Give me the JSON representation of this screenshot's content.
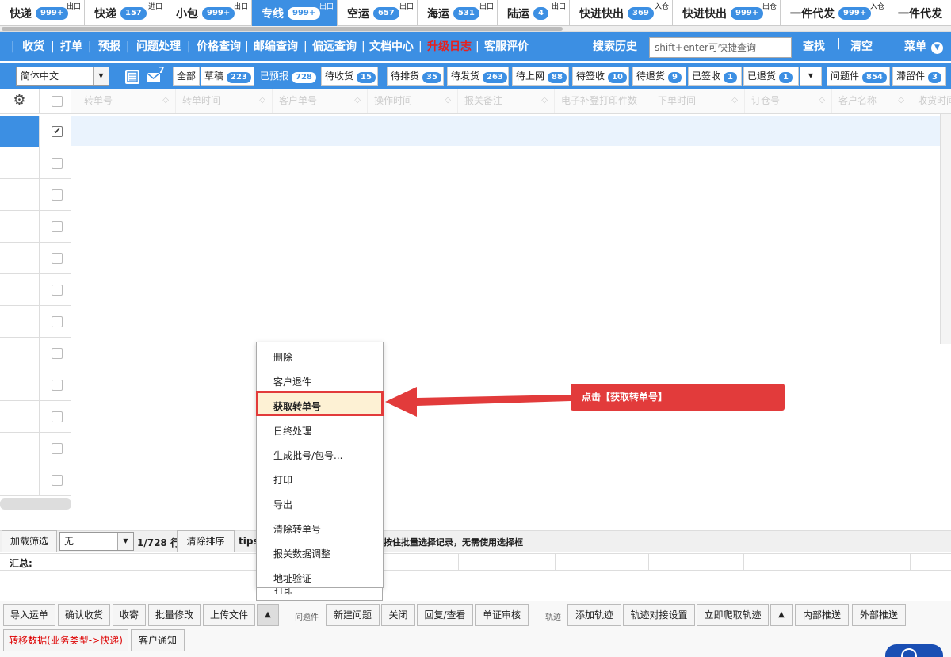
{
  "top_tabs": [
    {
      "label": "快递",
      "count": "999+",
      "sup": "出口"
    },
    {
      "label": "快递",
      "count": "157",
      "sup": "进口"
    },
    {
      "label": "小包",
      "count": "999+",
      "sup": "出口"
    },
    {
      "label": "专线",
      "count": "999+",
      "sup": "出口",
      "active": true
    },
    {
      "label": "空运",
      "count": "657",
      "sup": "出口"
    },
    {
      "label": "海运",
      "count": "531",
      "sup": "出口"
    },
    {
      "label": "陆运",
      "count": "4",
      "sup": "出口"
    },
    {
      "label": "快进快出",
      "count": "369",
      "sup": "入仓"
    },
    {
      "label": "快进快出",
      "count": "999+",
      "sup": "出仓"
    },
    {
      "label": "一件代发",
      "count": "999+",
      "sup": "入仓"
    },
    {
      "label": "一件代发",
      "count": "",
      "sup": ""
    }
  ],
  "nav": {
    "items": [
      "收货",
      "打单",
      "预报",
      "问题处理",
      "价格查询",
      "邮编查询",
      "偏远查询",
      "文档中心",
      "升级日志",
      "客服评价"
    ],
    "search_history": "搜索历史",
    "search_placeholder": "shift+enter可快捷查询",
    "find": "查找",
    "clear": "清空",
    "menu": "菜单"
  },
  "filter": {
    "language": "简体中文",
    "mail_badge": "7",
    "tabs": [
      {
        "label": "全部",
        "count": ""
      },
      {
        "label": "草稿",
        "count": "223"
      },
      {
        "label": "已预报",
        "count": "728",
        "active": true
      },
      {
        "label": "待收货",
        "count": "15"
      },
      {
        "label": "待排货",
        "count": "35"
      },
      {
        "label": "待发货",
        "count": "263"
      },
      {
        "label": "待上网",
        "count": "88"
      },
      {
        "label": "待签收",
        "count": "10"
      },
      {
        "label": "待退货",
        "count": "9"
      },
      {
        "label": "已签收",
        "count": "1"
      },
      {
        "label": "已退货",
        "count": "1"
      },
      {
        "label": "问题件",
        "count": "854"
      },
      {
        "label": "滞留件",
        "count": "3"
      }
    ]
  },
  "columns": [
    "转单号",
    "转单时间",
    "客户单号",
    "操作时间",
    "报关备注",
    "电子补登打印件数",
    "下单时间",
    "订仓号",
    "客户名称",
    "收货时间"
  ],
  "footer_bar": {
    "load_filter": "加载筛选",
    "filter_value": "无",
    "row_info": "1/728 行",
    "clear_sort": "清除排序",
    "tips_label": "tips",
    "tips_text": "按住批量选择记录，无需使用选择框"
  },
  "summary_label": "汇总:",
  "bottom": {
    "row1": [
      "导入运单",
      "确认收货",
      "收寄",
      "批量修改",
      "上传文件"
    ],
    "more_icon": "▲",
    "problem_group": "问题件",
    "problem_buttons": [
      "新建问题",
      "关闭",
      "回复/查看",
      "单证审核"
    ],
    "track_group": "轨迹",
    "track_buttons": [
      "添加轨迹",
      "轨迹对接设置",
      "立即爬取轨迹"
    ],
    "push_buttons": [
      "内部推送",
      "外部推送"
    ],
    "row2": [
      "转移数据(业务类型->快递)",
      "客户通知"
    ]
  },
  "popup_menu": [
    "删除",
    "客户退件",
    "获取转单号",
    "日终处理",
    "生成批号/包号...",
    "打印",
    "导出",
    "清除转单号",
    "报关数据调整",
    "地址验证"
  ],
  "popup_overflow": "打印",
  "highlighted_item": "获取转单号",
  "callout": "点击【获取转单号】",
  "colors": {
    "accent": "#3c8fe3",
    "callout": "#e23b3b",
    "highlight_bg": "#fdf1d4"
  }
}
